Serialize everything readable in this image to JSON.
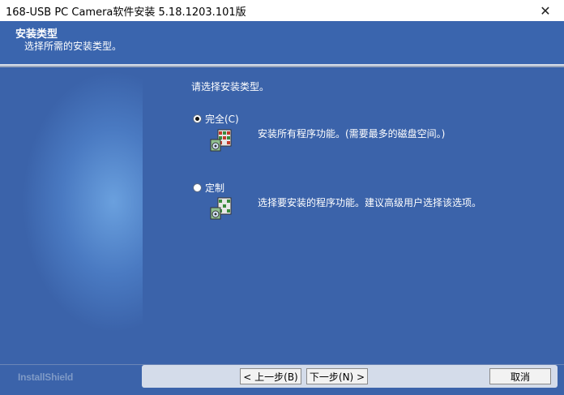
{
  "window": {
    "title": "168-USB PC Camera软件安装 5.18.1203.101版",
    "close_glyph": "✕"
  },
  "header": {
    "title": "安装类型",
    "subtitle": "选择所需的安装类型。"
  },
  "content": {
    "prompt": "请选择安装类型。",
    "options": [
      {
        "label": "完全(C)",
        "description": "安装所有程序功能。(需要最多的磁盘空间。)",
        "selected": true,
        "icon": "package-icon"
      },
      {
        "label": "定制",
        "description": "选择要安装的程序功能。建议高级用户选择该选项。",
        "selected": false,
        "icon": "package-icon"
      }
    ]
  },
  "footer": {
    "brand": "InstallShield",
    "back_label": "< 上一步(B)",
    "next_label": "下一步(N) >",
    "cancel_label": "取消"
  },
  "colors": {
    "background": "#3a62a8",
    "accent": "#3a65ae"
  }
}
